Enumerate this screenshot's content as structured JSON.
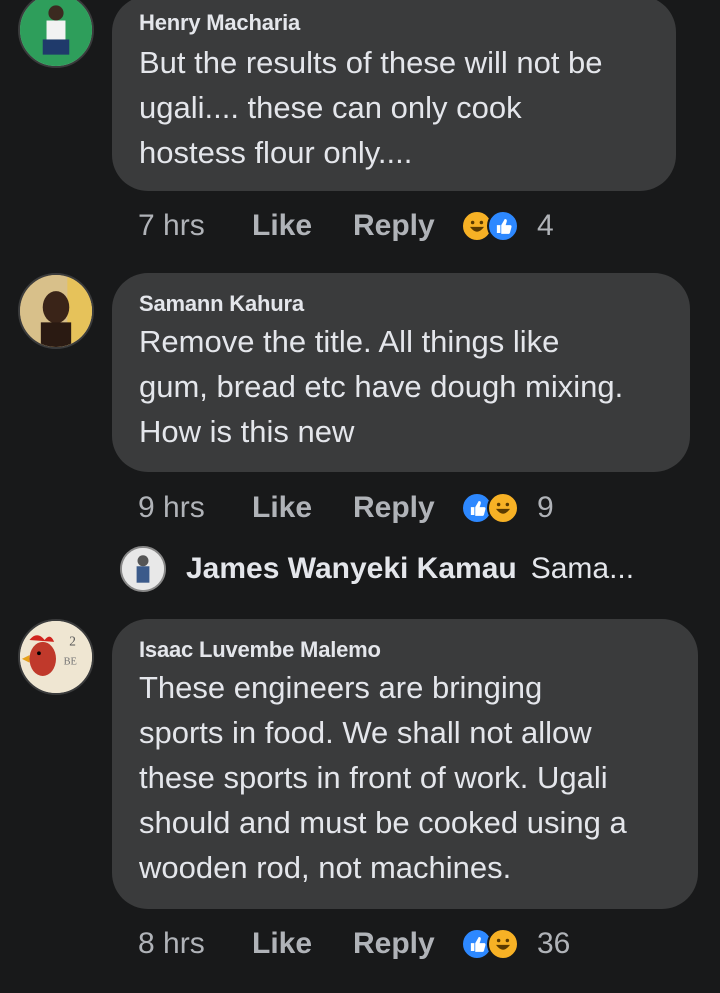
{
  "comments": [
    {
      "author": "Henry Macharia",
      "text": "But the results of these will not be ugali.... these can only cook hostess flour only....",
      "lines": [
        "But the results of these will not be",
        "ugali.... these can only cook",
        "hostess flour only...."
      ],
      "time": "7 hrs",
      "like_label": "Like",
      "reply_label": "Reply",
      "reactions": [
        "haha-icon",
        "like-icon"
      ],
      "reaction_count": "4"
    },
    {
      "author": "Samann Kahura",
      "lines": [
        "Remove the title. All things like",
        "gum, bread etc have dough mixing.",
        "How is this new"
      ],
      "time": "9 hrs",
      "like_label": "Like",
      "reply_label": "Reply",
      "reactions": [
        "like-icon",
        "haha-icon"
      ],
      "reaction_count": "9",
      "reply_preview": {
        "author": "James Wanyeki Kamau",
        "snippet": "Sama..."
      }
    },
    {
      "author": "Isaac Luvembe Malemo",
      "lines": [
        "These engineers are bringing",
        "sports in food. We shall not allow",
        "these sports in front of work. Ugali",
        "should and must be cooked using a",
        "wooden rod, not machines."
      ],
      "time": "8 hrs",
      "like_label": "Like",
      "reply_label": "Reply",
      "reactions": [
        "like-icon",
        "haha-icon"
      ],
      "reaction_count": "36"
    }
  ],
  "colors": {
    "background": "#18191a",
    "bubble": "#3a3b3c",
    "text": "#e4e6eb",
    "meta": "#b0b3b8",
    "like_reaction": "#2d88ff",
    "haha_reaction": "#f7b125"
  }
}
